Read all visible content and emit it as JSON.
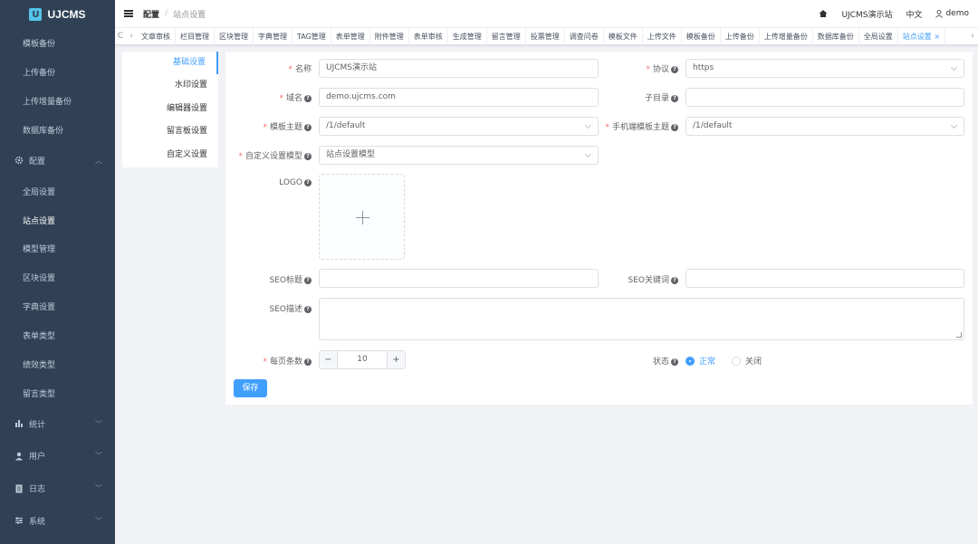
{
  "brand": {
    "name": "UJCMS",
    "mark": "U"
  },
  "sidebar": {
    "items_top": [
      "模板备份",
      "上传备份",
      "上传增量备份",
      "数据库备份"
    ],
    "config_group": "配置",
    "config_items": [
      "全局设置",
      "站点设置",
      "模型管理",
      "区块设置",
      "字典设置",
      "表单类型",
      "绩效类型",
      "留言类型"
    ],
    "active_item": "站点设置",
    "groups": [
      "统计",
      "用户",
      "日志",
      "系统"
    ]
  },
  "header": {
    "breadcrumb_1": "配置",
    "breadcrumb_sep": "/",
    "breadcrumb_2": "站点设置",
    "site_name": "UJCMS演示站",
    "language": "中文",
    "user": "demo"
  },
  "tabs": {
    "items": [
      "文章审核",
      "栏目管理",
      "区块管理",
      "字典管理",
      "TAG管理",
      "表单管理",
      "附件管理",
      "表单审核",
      "生成管理",
      "留言管理",
      "投票管理",
      "调查问卷",
      "模板文件",
      "上传文件",
      "模板备份",
      "上传备份",
      "上传增量备份",
      "数据库备份",
      "全局设置",
      "站点设置 ×"
    ],
    "active": "站点设置 ×",
    "prev": "‹",
    "next": "›",
    "refresh": "C"
  },
  "settings_nav": [
    "基础设置",
    "水印设置",
    "编辑器设置",
    "留言板设置",
    "自定义设置"
  ],
  "form": {
    "name_label": "名称",
    "name_value": "UJCMS演示站",
    "protocol_label": "协议",
    "protocol_value": "https",
    "domain_label": "域名",
    "domain_value": "demo.ujcms.com",
    "subdir_label": "子目录",
    "subdir_value": "",
    "theme_label": "模板主题",
    "theme_value": "/1/default",
    "mobile_theme_label": "手机端模板主题",
    "mobile_theme_value": "/1/default",
    "custom_model_label": "自定义设置模型",
    "custom_model_value": "站点设置模型",
    "logo_label": "LOGO",
    "seo_title_label": "SEO标题",
    "seo_keywords_label": "SEO关键词",
    "seo_desc_label": "SEO描述",
    "page_size_label": "每页条数",
    "page_size_value": "10",
    "status_label": "状态",
    "status_on": "正常",
    "status_off": "关闭",
    "save_label": "保存",
    "required_mark": "*",
    "help_mark": "?"
  },
  "colors": {
    "primary": "#409eff",
    "sidebar_bg": "#304156",
    "danger": "#f56c6c"
  }
}
